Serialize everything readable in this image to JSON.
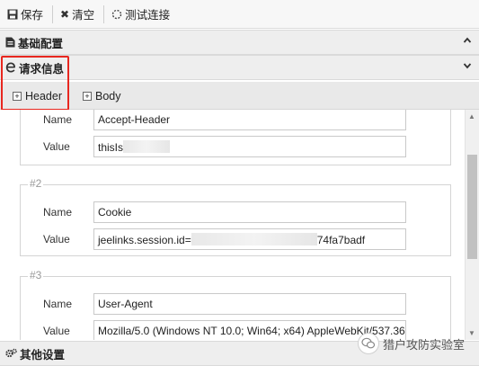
{
  "toolbar": {
    "save_label": "保存",
    "clear_label": "清空",
    "test_label": "测试连接"
  },
  "sections": {
    "basic": "基础配置",
    "request": "请求信息",
    "other": "其他设置"
  },
  "tabs": {
    "header": "Header",
    "body": "Body"
  },
  "headers": [
    {
      "legend": "",
      "name_label": "Name",
      "value_label": "Value",
      "name": "Accept-Header",
      "value": "thisIs"
    },
    {
      "legend": "#2",
      "name_label": "Name",
      "value_label": "Value",
      "name": "Cookie",
      "value_prefix": "jeelinks.session.id=",
      "value_suffix": "74fa7badf"
    },
    {
      "legend": "#3",
      "name_label": "Name",
      "value_label": "Value",
      "name": "User-Agent",
      "value": "Mozilla/5.0 (Windows NT 10.0; Win64; x64) AppleWebKit/537.36"
    }
  ],
  "watermark": "猎户攻防实验室",
  "icons": {
    "save": "save-icon",
    "clear": "close-icon",
    "test": "spinner-icon",
    "basic": "document-icon",
    "request": "ie-icon",
    "other": "gears-icon",
    "collapse": "chevron-up-icon",
    "expand": "chevron-down-icon",
    "tab": "plus-square-icon"
  }
}
